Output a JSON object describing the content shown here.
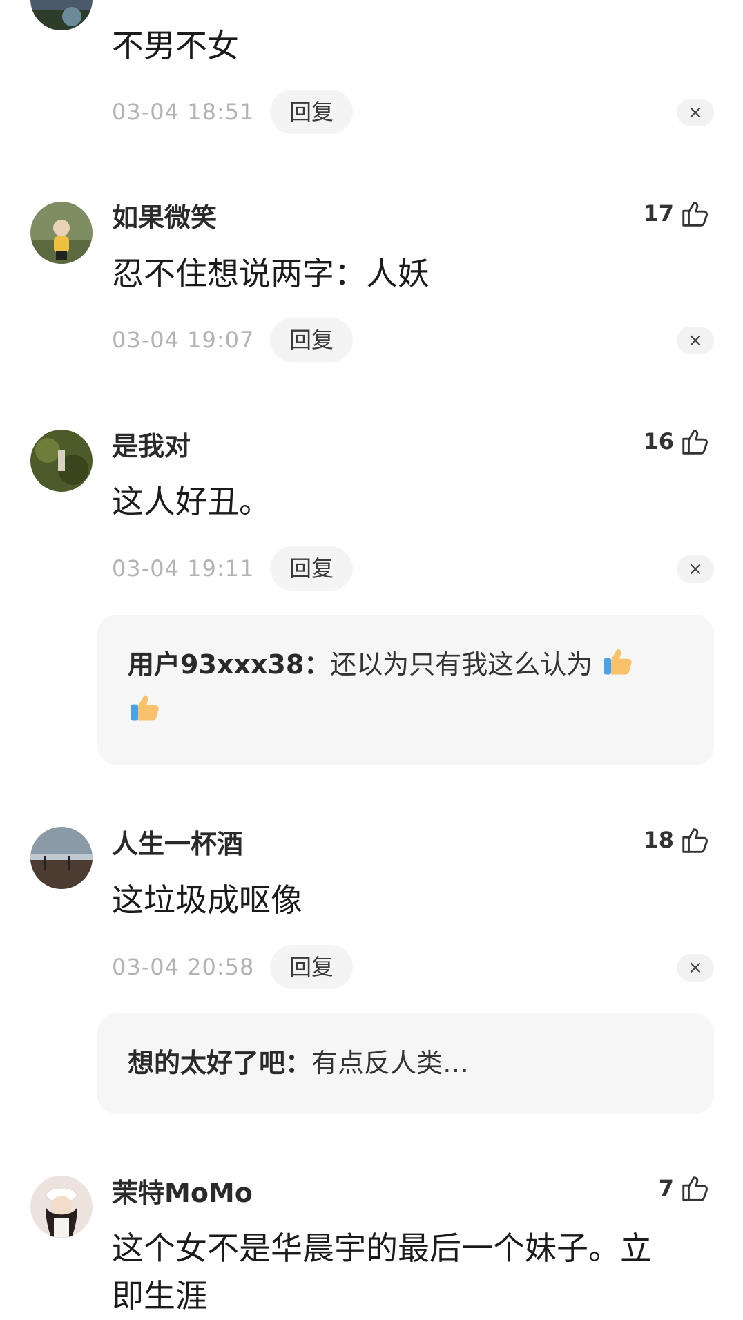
{
  "comments": [
    {
      "username": "",
      "content": "不男不女",
      "time": "03-04 18:51",
      "reply_label": "回复",
      "close_label": "×",
      "likes": null,
      "avatar_colors": [
        "#5a6e86",
        "#3b4a5c"
      ]
    },
    {
      "username": "如果微笑",
      "content": "忍不住想说两字：人妖",
      "time": "03-04 19:07",
      "reply_label": "回复",
      "close_label": "×",
      "likes": "17",
      "avatar_colors": [
        "#8a9a6c",
        "#4f5f3a"
      ]
    },
    {
      "username": "是我对",
      "content": "这人好丑。",
      "time": "03-04 19:11",
      "reply_label": "回复",
      "close_label": "×",
      "likes": "16",
      "avatar_colors": [
        "#6b7a3a",
        "#2f3a1c"
      ],
      "sub_reply": {
        "name": "用户93xxx38：",
        "text": "还以为只有我这么认为"
      }
    },
    {
      "username": "人生一杯酒",
      "content": "这垃圾成呕像",
      "time": "03-04 20:58",
      "reply_label": "回复",
      "close_label": "×",
      "likes": "18",
      "avatar_colors": [
        "#8899a6",
        "#4a3a30"
      ],
      "sub_reply": {
        "name": "想的太好了吧：",
        "text": "有点反人类…"
      }
    },
    {
      "username": "茉特MoMo",
      "content": "这个女不是华晨宇的最后一个妹子。立",
      "content_line2": "即生涯",
      "likes": "7",
      "avatar_colors": [
        "#e8dcd6",
        "#3a2a2a"
      ]
    }
  ],
  "icons": {
    "like": "thumbs-up-outline-icon",
    "close": "close-icon",
    "emoji": "thumbs-up-emoji-icon"
  }
}
